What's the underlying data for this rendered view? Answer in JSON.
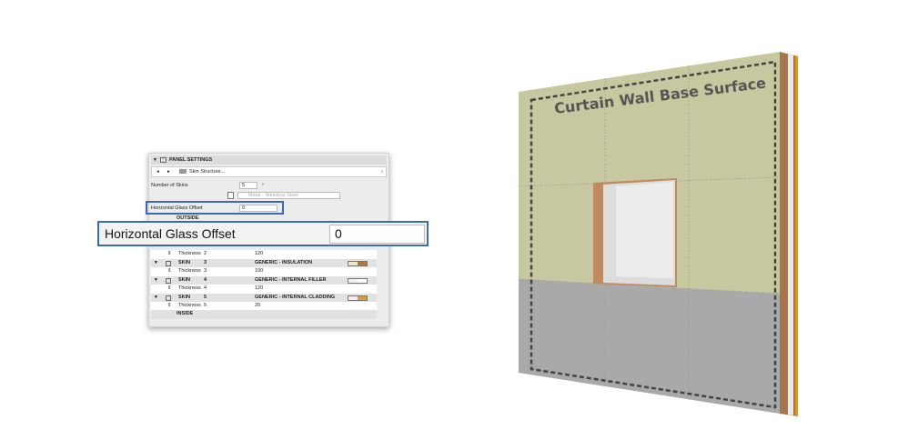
{
  "panel": {
    "title": "PANEL SETTINGS",
    "nav_label": "Skin Structure...",
    "num_skins_label": "Number of Skins",
    "num_skins_value": "5",
    "material": "Metal - Stainless Steel",
    "hgo_label": "Horizontal Glass Offset",
    "hgo_value": "0",
    "outside": "OUTSIDE",
    "inside": "INSIDE",
    "rows": [
      {
        "type": "th",
        "label": "Thickness",
        "n": "2",
        "value": "120"
      },
      {
        "type": "skin",
        "label": "SKIN",
        "n": "3",
        "value": "GENERIC - INSULATION",
        "c1": "#f2e6c8",
        "c2": "#b07a3a"
      },
      {
        "type": "th",
        "label": "Thickness",
        "n": "3",
        "value": "100"
      },
      {
        "type": "skin",
        "label": "SKIN",
        "n": "4",
        "value": "GENERIC - INTERNAL FILLER",
        "c1": "#f2efe6",
        "c2": "#ffffff"
      },
      {
        "type": "th",
        "label": "Thickness",
        "n": "4",
        "value": "120"
      },
      {
        "type": "skin",
        "label": "SKIN",
        "n": "5",
        "value": "GENERIC - INTERNAL CLADDING",
        "c1": "#f2efe6",
        "c2": "#d49a48"
      },
      {
        "type": "th",
        "label": "Thickness",
        "n": "5",
        "value": "20"
      }
    ]
  },
  "callout": {
    "label": "Horizontal Glass Offset",
    "value": "0"
  },
  "wall": {
    "caption": "Curtain Wall Base Surface",
    "colors": {
      "upper": "#c8c8a0",
      "lower": "#a9a9a9",
      "highlight": "#3d6bb3"
    }
  }
}
